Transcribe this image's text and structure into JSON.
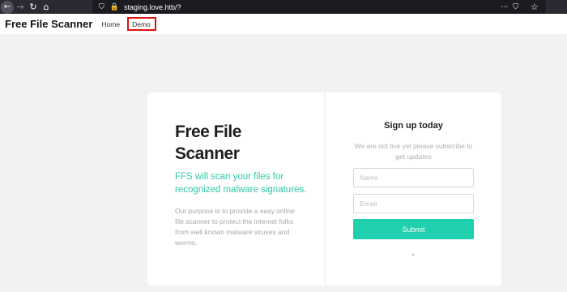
{
  "browser": {
    "url": "staging.love.htb/?",
    "back_icon": "back-arrow-icon",
    "forward_icon": "forward-arrow-icon",
    "reload_icon": "reload-icon",
    "home_icon": "home-icon",
    "back_glyph": "←",
    "forward_glyph": "→",
    "reload_glyph": "↻",
    "home_glyph": "⌂",
    "shield_glyph": "⛉",
    "lock_glyph": "🔒",
    "menu_glyph": "⋯",
    "pocket_glyph": "⛉",
    "bookmark_glyph": "☆"
  },
  "site_nav": {
    "brand": "Free File Scanner",
    "links": [
      "Home",
      "Demo"
    ],
    "highlight_color": "#e01010"
  },
  "hero": {
    "title": "Free File Scanner",
    "tagline": "FFS will scan your files for recognized malware signatures.",
    "description": "Our purpose is to provide a easy online file scanner to protect the internet folks from well known malware viruses and worms.",
    "accent_color": "#2ec9a7"
  },
  "signup": {
    "title": "Sign up today",
    "subtitle": "We are not live yet please subscribe to get updates",
    "name_placeholder": "Name",
    "email_placeholder": "Email",
    "submit_label": "Submit",
    "button_color": "#1fcfad"
  }
}
